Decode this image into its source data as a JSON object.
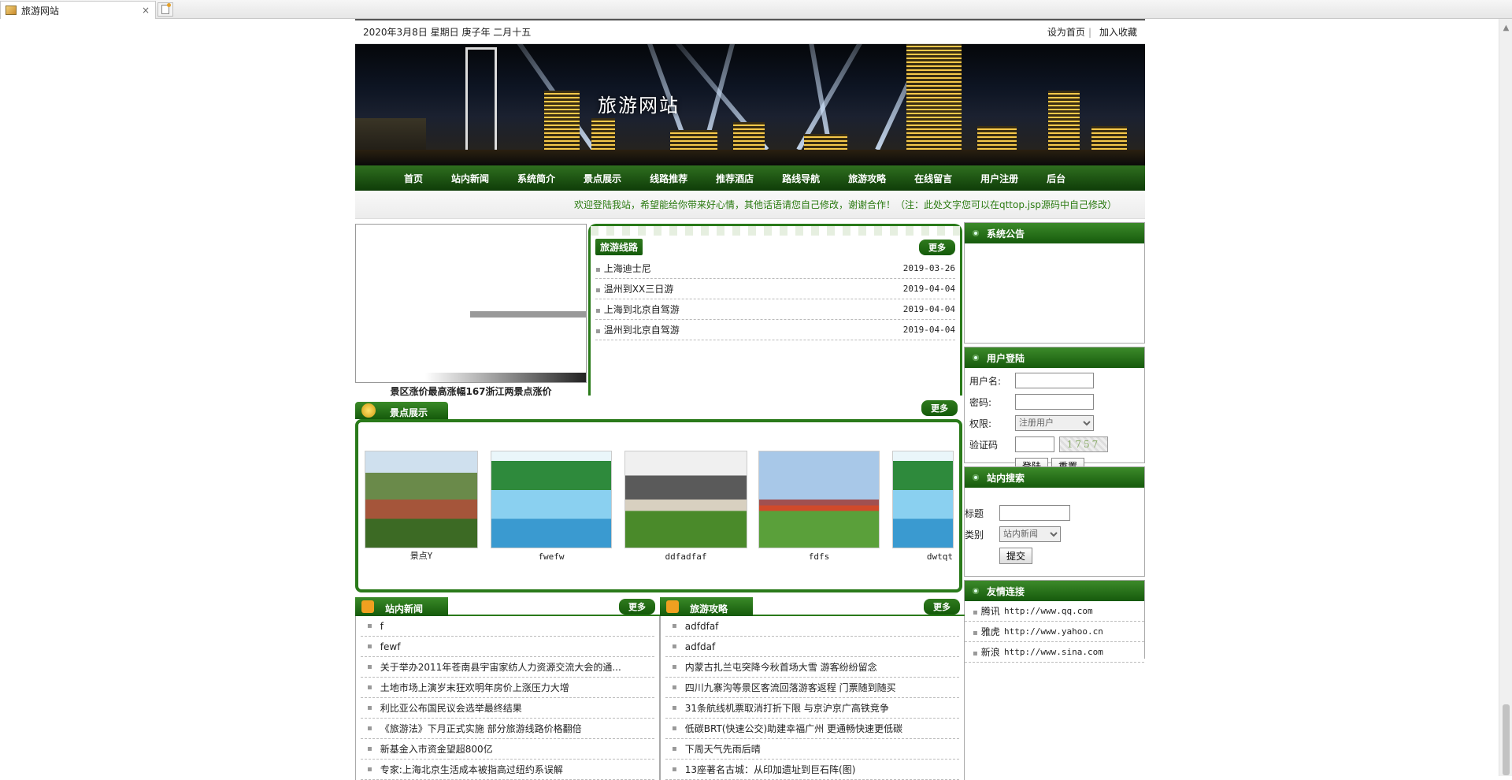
{
  "browser": {
    "tab_title": "旅游网站",
    "close": "×"
  },
  "topbar": {
    "date": "2020年3月8日 星期日 庚子年 二月十五",
    "set_home": "设为首页",
    "separator": "|",
    "favorite": "加入收藏"
  },
  "banner": {
    "title": "旅游网站"
  },
  "nav": [
    "首页",
    "站内新闻",
    "系统简介",
    "景点展示",
    "线路推荐",
    "推荐酒店",
    "路线导航",
    "旅游攻略",
    "在线留言",
    "用户注册",
    "后台"
  ],
  "marquee": "欢迎登陆我站，希望能给你带来好心情，其他话语请您自己修改，谢谢合作！（注：此处文字您可以在qttop.jsp源码中自己修改）",
  "slideshow": {
    "caption": "景区涨价最高涨幅167浙江两景点涨价"
  },
  "routes": {
    "title": "旅游线路",
    "more": "更多",
    "items": [
      {
        "name": "上海迪士尼",
        "date": "2019-03-26"
      },
      {
        "name": "温州到XX三日游",
        "date": "2019-04-04"
      },
      {
        "name": "上海到北京自驾游",
        "date": "2019-04-04"
      },
      {
        "name": "温州到北京自驾游",
        "date": "2019-04-04"
      }
    ]
  },
  "notice": {
    "title": "系统公告"
  },
  "login": {
    "title": "用户登陆",
    "username_label": "用户名:",
    "password_label": "密码:",
    "role_label": "权限:",
    "role_value": "注册用户",
    "captcha_label": "验证码",
    "captcha_text": "1757",
    "login_btn": "登陆",
    "reset_btn": "重置"
  },
  "search": {
    "title": "站内搜索",
    "title_label": "标题",
    "type_label": "类别",
    "type_value": "站内新闻",
    "submit": "提交"
  },
  "friends": {
    "title": "友情连接",
    "items": [
      {
        "name": "腾讯",
        "url": "http://www.qq.com"
      },
      {
        "name": "雅虎",
        "url": "http://www.yahoo.cn"
      },
      {
        "name": "新浪",
        "url": "http://www.sina.com"
      }
    ]
  },
  "scenic": {
    "title": "景点展示",
    "more": "更多",
    "items": [
      {
        "caption": "景点Y",
        "icon": "mountain-photo"
      },
      {
        "caption": "fwefw",
        "icon": "lake-photo"
      },
      {
        "caption": "ddfadfaf",
        "icon": "village-photo"
      },
      {
        "caption": "fdfs",
        "icon": "park-arch-photo"
      },
      {
        "caption": "dwtqt",
        "icon": "lake-photo"
      }
    ]
  },
  "news": {
    "title": "站内新闻",
    "more": "更多",
    "items": [
      "f",
      "fewf",
      "关于举办2011年苍南县宇宙家纺人力资源交流大会的通...",
      "土地市场上演岁末狂欢明年房价上涨压力大增",
      "利比亚公布国民议会选举最终结果",
      "《旅游法》下月正式实施 部分旅游线路价格翻倍",
      "新基金入市资金望超800亿",
      "专家:上海北京生活成本被指高过纽约系误解"
    ]
  },
  "guides": {
    "title": "旅游攻略",
    "more": "更多",
    "items": [
      "adfdfaf",
      "adfdaf",
      "内蒙古扎兰屯突降今秋首场大雪 游客纷纷留念",
      "四川九寨沟等景区客流回落游客返程 门票随到随买",
      "31条航线机票取消打折下限 与京沪京广高铁竞争",
      "低碳BRT(快速公交)助建幸福广州 更通畅快速更低碳",
      "下周天气先雨后晴",
      "13座著名古城：从印加遗址到巨石阵(图)"
    ]
  }
}
